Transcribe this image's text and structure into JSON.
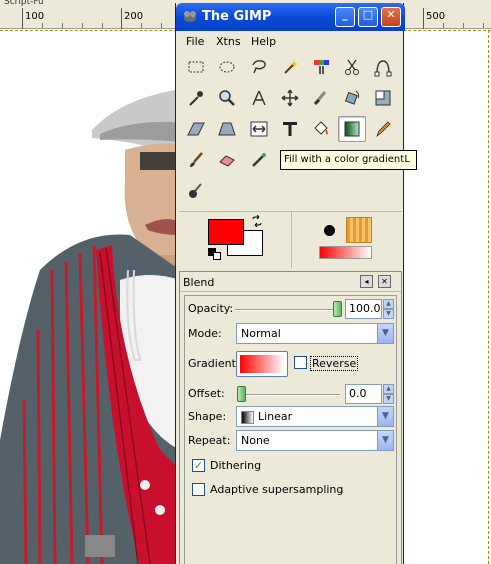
{
  "background_window": {
    "title_fragment": "Script-Fu",
    "ruler_labels": [
      "100",
      "200",
      "500"
    ]
  },
  "window": {
    "title": "The GIMP",
    "buttons": {
      "minimize": "_",
      "maximize": "□",
      "close": "✕"
    }
  },
  "menu": [
    {
      "label": "File"
    },
    {
      "label": "Xtns"
    },
    {
      "label": "Help"
    }
  ],
  "tools": [
    {
      "icon": "rect-select-icon"
    },
    {
      "icon": "ellipse-select-icon"
    },
    {
      "icon": "lasso-icon"
    },
    {
      "icon": "fuzzy-select-icon"
    },
    {
      "icon": "color-select-icon"
    },
    {
      "icon": "scissors-icon"
    },
    {
      "icon": "paths-icon"
    },
    {
      "icon": "color-picker-icon"
    },
    {
      "icon": "zoom-icon"
    },
    {
      "icon": "measure-icon"
    },
    {
      "icon": "move-icon"
    },
    {
      "icon": "crop-icon"
    },
    {
      "icon": "rotate-icon"
    },
    {
      "icon": "scale-icon"
    },
    {
      "icon": "shear-icon"
    },
    {
      "icon": "perspective-icon"
    },
    {
      "icon": "flip-icon"
    },
    {
      "icon": "text-icon"
    },
    {
      "icon": "bucket-fill-icon"
    },
    {
      "icon": "blend-icon",
      "selected": true
    },
    {
      "icon": "pencil-icon"
    },
    {
      "icon": "paintbrush-icon"
    },
    {
      "icon": "eraser-icon"
    },
    {
      "icon": "airbrush-icon"
    },
    {
      "icon": "smudge-icon"
    }
  ],
  "tooltip": {
    "text": "Fill with a color gradient",
    "shortcut": "L"
  },
  "colors": {
    "foreground": "#ff0000",
    "background": "#ffffff",
    "accent_title": "#0b4ad8"
  },
  "tool_options": {
    "title": "Blend",
    "opacity_label": "Opacity:",
    "opacity_value": "100.0",
    "opacity_fraction": 1.0,
    "mode_label": "Mode:",
    "mode_value": "Normal",
    "gradient_label": "Gradient:",
    "reverse_label": "Reverse",
    "reverse_checked": false,
    "offset_label": "Offset:",
    "offset_value": "0.0",
    "offset_fraction": 0.0,
    "shape_label": "Shape:",
    "shape_value": "Linear",
    "repeat_label": "Repeat:",
    "repeat_value": "None",
    "dithering_label": "Dithering",
    "dithering_checked": true,
    "supersampling_label": "Adaptive supersampling",
    "supersampling_checked": false
  }
}
